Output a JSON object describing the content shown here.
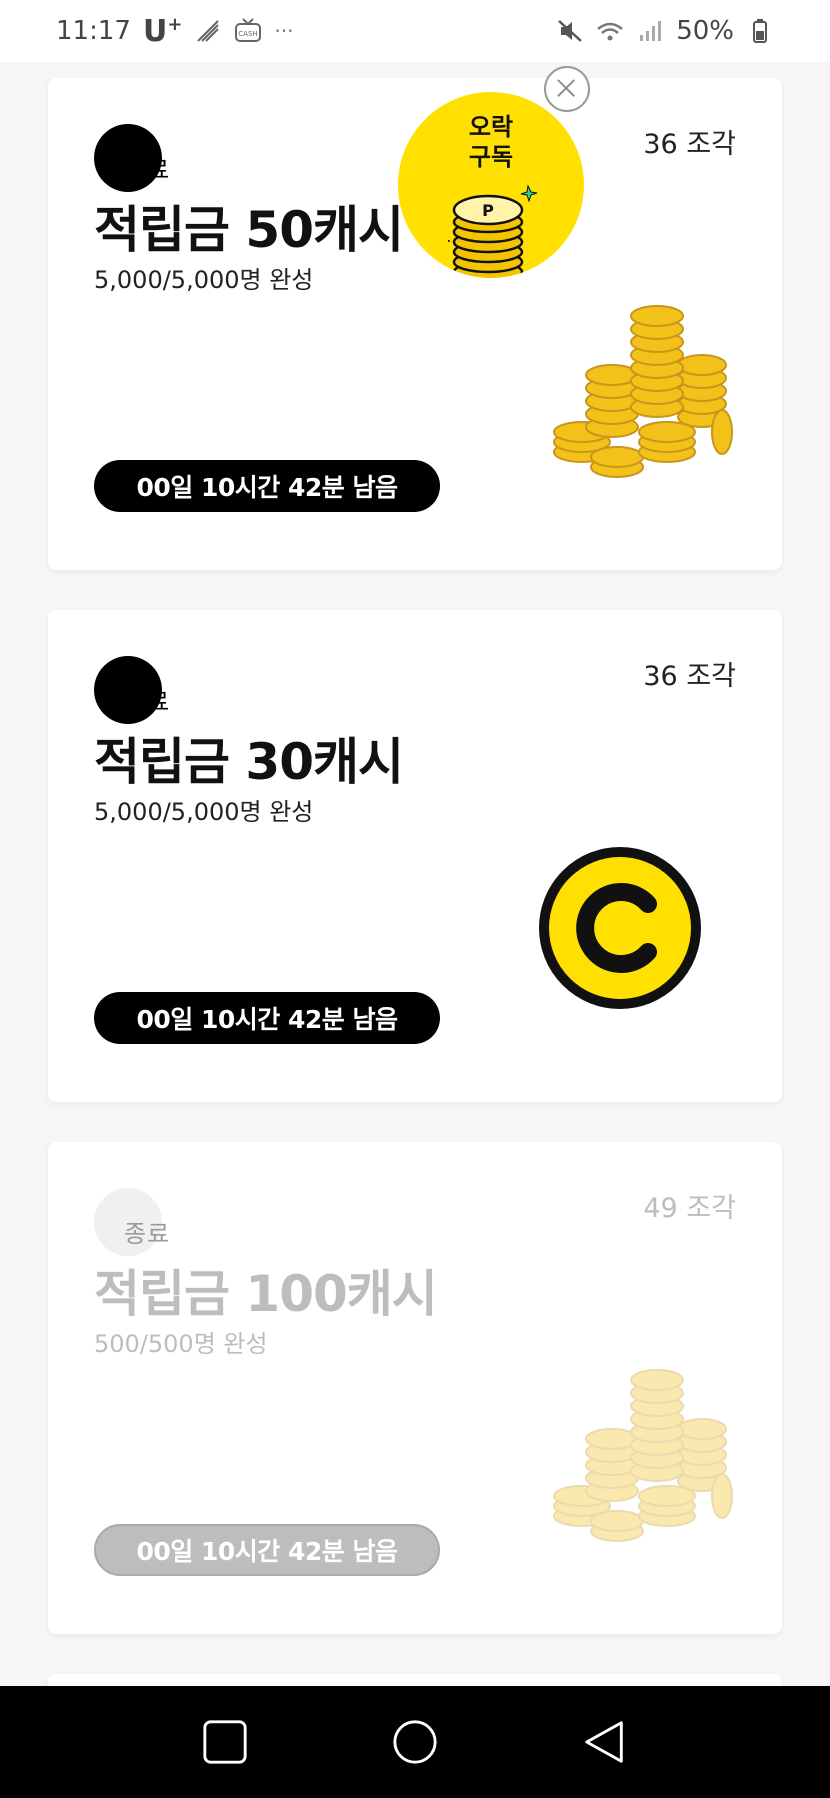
{
  "status_bar": {
    "time": "11:17",
    "carrier": "U",
    "carrier_sup": "+",
    "dots": "···",
    "battery": "50%"
  },
  "ad": {
    "line1": "오락",
    "line2": "구독"
  },
  "cards": [
    {
      "status": "완료",
      "pieces": "36 조각",
      "title": "적립금 50캐시",
      "progress": "5,000/5,000명 완성",
      "timer": "00일 10시간 42분 남음",
      "image": "coin-stack"
    },
    {
      "status": "완료",
      "pieces": "36 조각",
      "title": "적립금 30캐시",
      "progress": "5,000/5,000명 완성",
      "timer": "00일 10시간 42분 남음",
      "image": "c-logo"
    },
    {
      "status": "종료",
      "pieces": "49 조각",
      "title": "적립금 100캐시",
      "progress": "500/500명 완성",
      "timer": "00일 10시간 42분 남음",
      "image": "coin-stack"
    }
  ],
  "colors": {
    "accent_yellow": "#ffe000",
    "active_timer": "#000000",
    "ended_timer": "#bdbdbd"
  }
}
